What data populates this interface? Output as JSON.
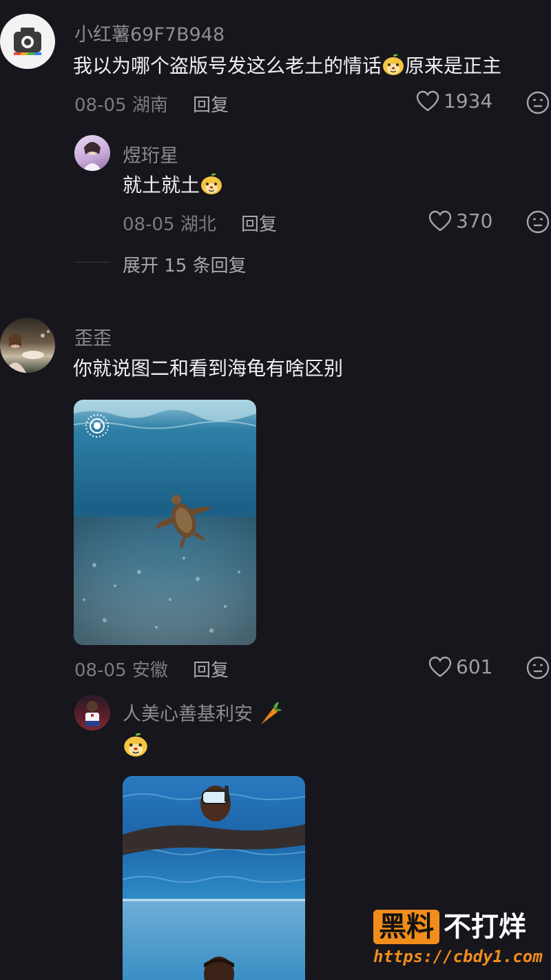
{
  "comments": [
    {
      "user": "小红薯69F7B948",
      "text_before_emoji": "我以为哪个盗版号发这么老土的情话",
      "text_after_emoji": "原来是正主",
      "date": "08-05",
      "region": "湖南",
      "reply_label": "回复",
      "likes": "1934",
      "replies": [
        {
          "user": "煜珩星",
          "text": "就土就土",
          "date": "08-05",
          "region": "湖北",
          "reply_label": "回复",
          "likes": "370"
        }
      ],
      "expand_label": "展开 15 条回复"
    },
    {
      "user": "歪歪",
      "text": "你就说图二和看到海龟有啥区别",
      "date": "08-05",
      "region": "安徽",
      "reply_label": "回复",
      "likes": "601",
      "replies": [
        {
          "user": "人美心善基利安"
        }
      ]
    }
  ],
  "watermark": {
    "brand_main": "黑料",
    "brand_rest": "不打烊",
    "url": "https://cbdy1.com"
  },
  "colors": {
    "background": "#17161c",
    "name_gray": "#8d8c91",
    "brand_orange": "#f18d1b"
  }
}
